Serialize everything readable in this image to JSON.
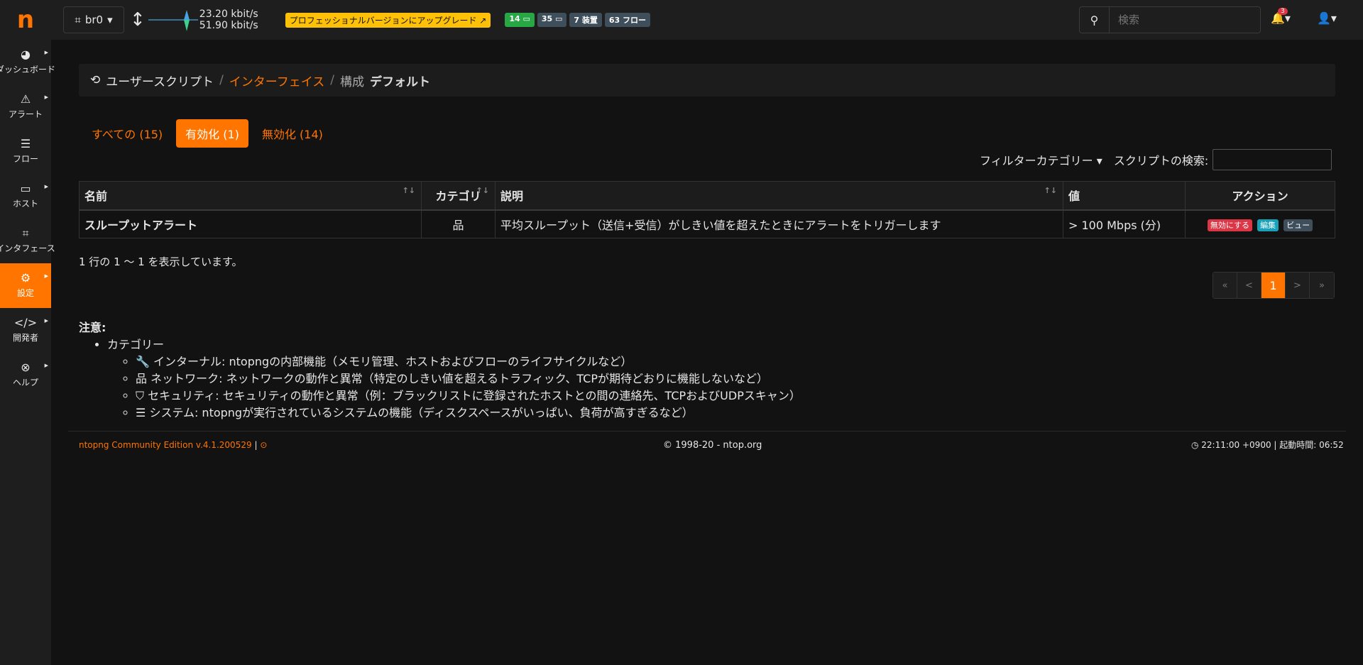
{
  "sidebar": {
    "logo": "n",
    "items": [
      {
        "icon": "◕",
        "label": "ダッシュボード"
      },
      {
        "icon": "⚠",
        "label": "アラート"
      },
      {
        "icon": "☰",
        "label": "フロー"
      },
      {
        "icon": "▭",
        "label": "ホスト"
      },
      {
        "icon": "⌗",
        "label": "インタフェース"
      },
      {
        "icon": "⚙",
        "label": "設定"
      },
      {
        "icon": "</>",
        "label": "開発者"
      },
      {
        "icon": "⊗",
        "label": "ヘルプ"
      }
    ]
  },
  "topbar": {
    "interface": "br0",
    "rate_up": "23.20 kbit/s",
    "rate_down": "51.90 kbit/s",
    "upgrade": "プロフェッショナルバージョンにアップグレード ↗",
    "badges": [
      "14 ▭",
      "35 ▭",
      "7 装置",
      "63 フロー"
    ],
    "search_placeholder": "検索",
    "alert_count": "3"
  },
  "breadcrumb": {
    "root": "ユーザースクリプト",
    "link": "インターフェイス",
    "current_prefix": "構成",
    "current": "デフォルト"
  },
  "tabs": [
    "すべての (15)",
    "有効化 (1)",
    "無効化 (14)"
  ],
  "filter": {
    "category_label": "フィルターカテゴリー",
    "search_label": "スクリプトの検索:"
  },
  "table": {
    "headers": [
      "名前",
      "カテゴリ",
      "説明",
      "値",
      "アクション"
    ],
    "rows": [
      {
        "name": "スループットアラート",
        "category_icon": "network-icon",
        "description": "平均スループット（送信+受信）がしきい値を超えたときにアラートをトリガーします",
        "value": "> 100 Mbps (分)",
        "actions": [
          "無効にする",
          "編集",
          "ビュー"
        ]
      }
    ]
  },
  "info": "1 行の 1 ～ 1 を表示しています。",
  "pager": [
    "«",
    "<",
    "1",
    ">",
    "»"
  ],
  "notes": {
    "title": "注意:",
    "category": "カテゴリー",
    "items": [
      {
        "icon": "🔧",
        "text": "インターナル: ntopngの内部機能（メモリ管理、ホストおよびフローのライフサイクルなど）"
      },
      {
        "icon": "品",
        "text": "ネットワーク: ネットワークの動作と異常（特定のしきい値を超えるトラフィック、TCPが期待どおりに機能しないなど）"
      },
      {
        "icon": "⛉",
        "text": "セキュリティ: セキュリティの動作と異常（例：ブラックリストに登録されたホストとの間の連絡先、TCPおよびUDPスキャン）"
      },
      {
        "icon": "☰",
        "text": "システム: ntopngが実行されているシステムの機能（ディスクスペースがいっぱい、負荷が高すぎるなど）"
      }
    ]
  },
  "footer": {
    "edition": "ntopng Community Edition v.4.1.200529",
    "copyright": "© 1998-20 - ntop.org",
    "time": "◷ 22:11:00 +0900 | 起動時間: 06:52"
  }
}
